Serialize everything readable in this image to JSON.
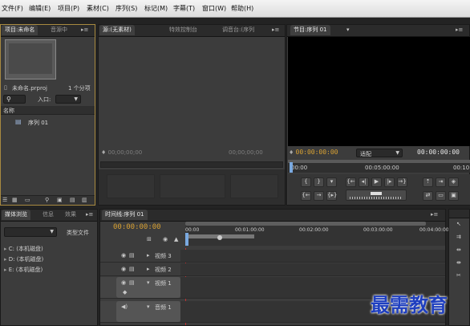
{
  "menu": [
    "文件(F)",
    "编辑(E)",
    "项目(P)",
    "素材(C)",
    "序列(S)",
    "标记(M)",
    "字幕(T)",
    "窗口(W)",
    "帮助(H)"
  ],
  "project_panel": {
    "tabs": [
      "项目:未命名",
      "音源中"
    ],
    "file_name": "未命名.prproj",
    "item_count": "1 个分项",
    "entry_label": "入口:",
    "column_name": "名称",
    "sequence_item": "序列 01"
  },
  "source_panel": {
    "tabs": [
      "源:(无素材)",
      "特效控制台",
      "调音台:(序列"
    ],
    "timecode_left": "00;00;00;00",
    "timecode_right": "00;00;00;00"
  },
  "program_panel": {
    "tab": "节目:序列 01",
    "timecode_current": "00:00:00:00",
    "fit_option": "适配",
    "timecode_duration": "00:00:00:00",
    "ruler": [
      "00:00",
      "00:05:00:00",
      "00:10"
    ]
  },
  "media_browser": {
    "tabs": [
      "媒体浏览",
      "信息",
      "效果"
    ],
    "file_type_label": "类型文件",
    "drives": [
      "C: (本机磁盘)",
      "D: (本机磁盘)",
      "E: (本机磁盘)"
    ]
  },
  "timeline": {
    "tab": "时间线:序列 01",
    "timecode": "00:00:00:00",
    "ruler": [
      "00:00",
      "00:01:00:00",
      "00:02:00:00",
      "00:03:00:00",
      "00:04:00:00"
    ],
    "tracks": [
      "视频 3",
      "视频 2",
      "视频 1",
      "音频 1"
    ]
  },
  "watermark": "最需教育",
  "colors": {
    "timecode_orange": "#d8a133",
    "watermark_blue": "#1f3fbf"
  }
}
